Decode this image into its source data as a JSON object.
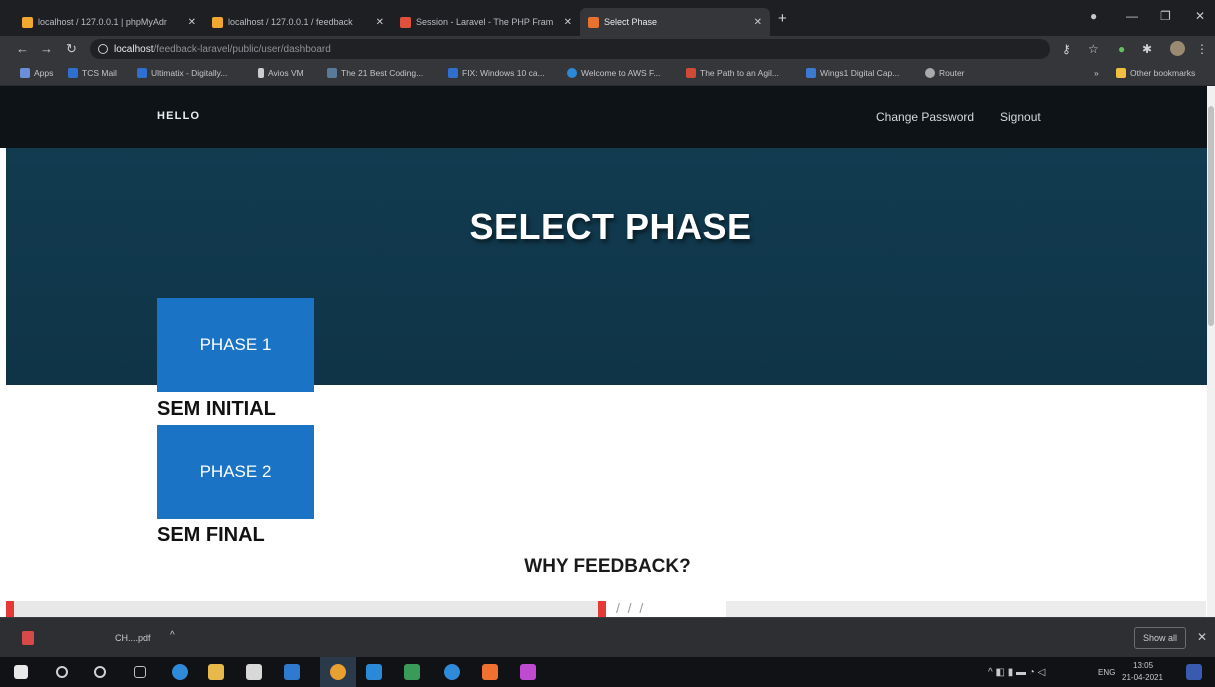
{
  "browser": {
    "tabs": [
      {
        "title": "localhost / 127.0.0.1 | phpMyAdr",
        "favicon_color": "#f0a830"
      },
      {
        "title": "localhost / 127.0.0.1 / feedback",
        "favicon_color": "#f0a830"
      },
      {
        "title": "Session - Laravel - The PHP Fram",
        "favicon_color": "#e0503c"
      },
      {
        "title": "Select Phase",
        "favicon_color": "#e8712d"
      }
    ],
    "url": {
      "host": "localhost",
      "path": "/feedback-laravel/public/user/dashboard"
    },
    "bookmarks": [
      {
        "label": "Apps",
        "color": "#6a8fd8"
      },
      {
        "label": "TCS Mail",
        "color": "#2f6fd0"
      },
      {
        "label": "Ultimatix - Digitally...",
        "color": "#2f6fd0"
      },
      {
        "label": "Avios VM",
        "color": "#cccccc"
      },
      {
        "label": "The 21 Best Coding...",
        "color": "#5a7a9a"
      },
      {
        "label": "FIX: Windows 10 ca...",
        "color": "#2f6fd0"
      },
      {
        "label": "Welcome to AWS F...",
        "color": "#2a8ad8"
      },
      {
        "label": "The Path to an Agil...",
        "color": "#d04a3a"
      },
      {
        "label": "Wings1 Digital Cap...",
        "color": "#3a7ad0"
      },
      {
        "label": "Router",
        "color": "#aaaaaa"
      },
      {
        "label": "Other bookmarks",
        "color": "#f0c040"
      }
    ]
  },
  "site": {
    "brand": "HELLO",
    "nav": {
      "change_password": "Change Password",
      "signout": "Signout"
    },
    "hero_title": "SELECT PHASE",
    "phases": [
      {
        "button": "PHASE 1",
        "label": "SEM INITIAL"
      },
      {
        "button": "PHASE 2",
        "label": "SEM FINAL"
      }
    ],
    "section_title": "WHY FEEDBACK?"
  },
  "downloads": {
    "file_name": "CH....pdf",
    "show_all": "Show all"
  },
  "taskbar": {
    "time": "13:05",
    "date": "21-04-2021",
    "lang": "ENG"
  },
  "colors": {
    "hero": "#123b50",
    "phase_button": "#1a73c4",
    "nav_bg": "#0e1317"
  }
}
